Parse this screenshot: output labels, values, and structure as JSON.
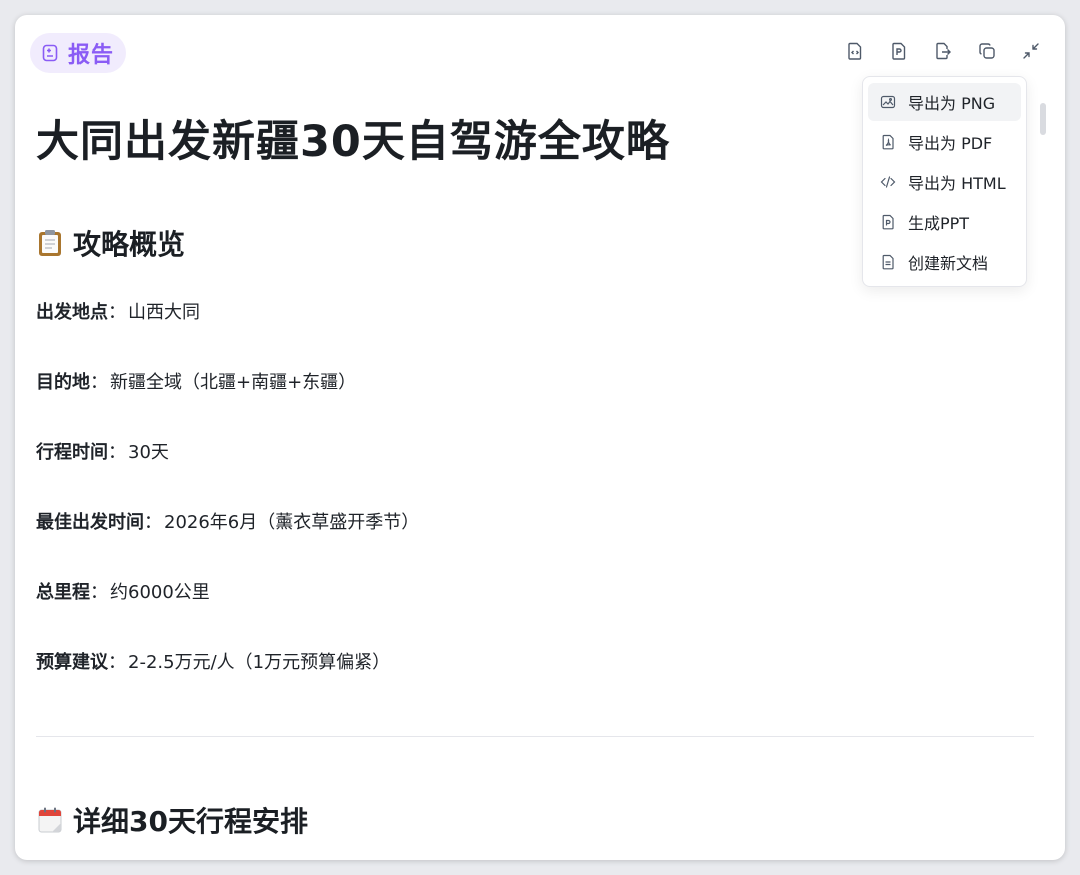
{
  "header": {
    "badge_label": "报告",
    "badge_icon": "report-icon"
  },
  "toolbar": {
    "buttons": [
      {
        "icon": "code-file-icon"
      },
      {
        "icon": "ppt-file-icon"
      },
      {
        "icon": "export-file-icon"
      },
      {
        "icon": "copy-icon"
      },
      {
        "icon": "collapse-icon"
      }
    ]
  },
  "menu": {
    "items": [
      {
        "label": "导出为 PNG",
        "icon": "image-icon"
      },
      {
        "label": "导出为 PDF",
        "icon": "pdf-icon"
      },
      {
        "label": "导出为 HTML",
        "icon": "code-icon"
      },
      {
        "label": "生成PPT",
        "icon": "ppt-icon"
      },
      {
        "label": "创建新文档",
        "icon": "document-icon"
      }
    ]
  },
  "document": {
    "title": "大同出发新疆30天自驾游全攻略",
    "overview_heading": "攻略概览",
    "separator": "：",
    "fields": [
      {
        "label": "出发地点",
        "value": "山西大同"
      },
      {
        "label": "目的地",
        "value": "新疆全域（北疆+南疆+东疆）"
      },
      {
        "label": "行程时间",
        "value": "30天"
      },
      {
        "label": "最佳出发时间",
        "value": "2026年6月（薰衣草盛开季节）"
      },
      {
        "label": "总里程",
        "value": "约6000公里"
      },
      {
        "label": "预算建议",
        "value": "2-2.5万元/人（1万元预算偏紧）"
      }
    ],
    "itinerary_heading": "详细30天行程安排"
  },
  "colors": {
    "accent": "#8a5cf5",
    "badge_bg": "#f1ecfd",
    "text": "#1f2329"
  }
}
